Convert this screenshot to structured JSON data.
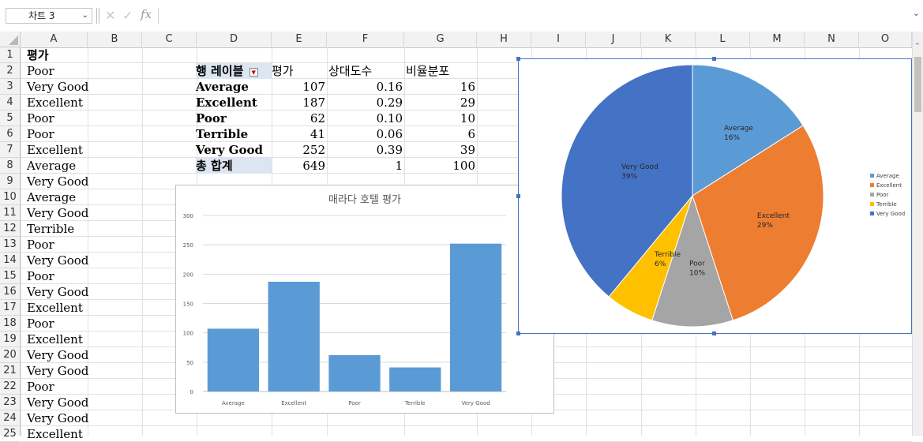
{
  "formula_bar": {
    "name_box": "차트 3",
    "fx": "fx",
    "formula": ""
  },
  "columns": [
    "A",
    "B",
    "C",
    "D",
    "E",
    "F",
    "G",
    "H",
    "I",
    "J",
    "K",
    "L",
    "M",
    "N",
    "O"
  ],
  "rows": [
    "1",
    "2",
    "3",
    "4",
    "5",
    "6",
    "7",
    "8",
    "9",
    "10",
    "11",
    "12",
    "13",
    "14",
    "15",
    "16",
    "17",
    "18",
    "19",
    "20",
    "21",
    "22",
    "23",
    "24",
    "25"
  ],
  "column_a": [
    "평가",
    "Poor",
    "Very Good",
    "Excellent",
    "Poor",
    "Poor",
    "Excellent",
    "Average",
    "Very Good",
    "Average",
    "Very Good",
    "Terrible",
    "Poor",
    "Very Good",
    "Poor",
    "Very Good",
    "Excellent",
    "Poor",
    "Excellent",
    "Very Good",
    "Very Good",
    "Poor",
    "Very Good",
    "Very Good",
    "Excellent"
  ],
  "pivot": {
    "header": {
      "label": "행 레이블",
      "col_e": "평가",
      "col_f": "상대도수",
      "col_g": "비율분포"
    },
    "rows": [
      {
        "label": "Average",
        "count": "107",
        "rel": "0.16",
        "pct": "16"
      },
      {
        "label": "Excellent",
        "count": "187",
        "rel": "0.29",
        "pct": "29"
      },
      {
        "label": "Poor",
        "count": "62",
        "rel": "0.10",
        "pct": "10"
      },
      {
        "label": "Terrible",
        "count": "41",
        "rel": "0.06",
        "pct": "6"
      },
      {
        "label": "Very Good",
        "count": "252",
        "rel": "0.39",
        "pct": "39"
      }
    ],
    "total": {
      "label": "총 합계",
      "count": "649",
      "rel": "1",
      "pct": "100"
    }
  },
  "colors": {
    "bar": "#5b9bd5",
    "selection": "#4472c4"
  },
  "chart_data": [
    {
      "type": "bar",
      "title": "매라다 호텔 평가",
      "categories": [
        "Average",
        "Excellent",
        "Poor",
        "Terrible",
        "Very Good"
      ],
      "values": [
        107,
        187,
        62,
        41,
        252
      ],
      "ylim": [
        0,
        300
      ],
      "yticks": [
        0,
        50,
        100,
        150,
        200,
        250,
        300
      ],
      "xlabel": "",
      "ylabel": "",
      "grid": true
    },
    {
      "type": "pie",
      "title": "",
      "categories": [
        "Average",
        "Excellent",
        "Poor",
        "Terrible",
        "Very Good"
      ],
      "values": [
        16,
        29,
        10,
        6,
        39
      ],
      "labels": [
        "16%",
        "29%",
        "10%",
        "6%",
        "39%"
      ],
      "colors": [
        "#5b9bd5",
        "#ed7d31",
        "#a5a5a5",
        "#ffc000",
        "#4472c4"
      ],
      "legend": "right"
    }
  ]
}
